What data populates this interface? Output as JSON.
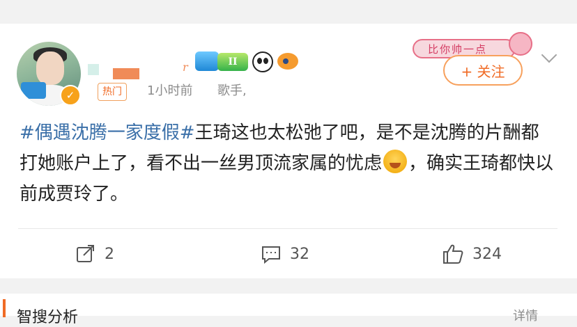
{
  "post": {
    "hot_tag": "热门",
    "time": "1小时前",
    "source": "歌手,",
    "follow_label": "+ 关注",
    "banner_text": "比你帅一点",
    "level_badge": "II",
    "nickname_tail": "r",
    "content_topic": "#偶遇沈腾一家度假#",
    "content_text_1": "王琦这也太松弛了吧，是不是沈腾的片酬都打她账户上了，看不出一丝男顶流家属的忧虑",
    "content_text_2": "，确实王琦都快以前成贾玲了。",
    "emoji_name": "laughing-crying-emoji"
  },
  "actions": {
    "repost_count": "2",
    "comment_count": "32",
    "like_count": "324"
  },
  "bottom": {
    "section_title": "智搜分析",
    "more_label": "详情"
  },
  "colors": {
    "accent": "#f06b25",
    "topic": "#3a6fa8"
  }
}
